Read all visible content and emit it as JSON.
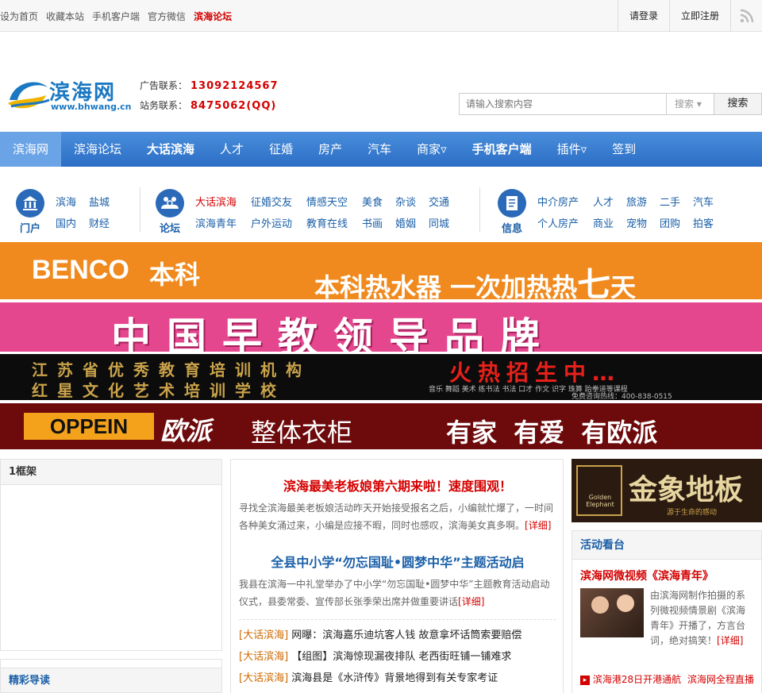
{
  "topbar": {
    "links": [
      "设为首页",
      "收藏本站",
      "手机客户端",
      "官方微信",
      "滨海论坛"
    ],
    "login": "请登录",
    "register": "立即注册"
  },
  "header": {
    "logo_text": "滨海网",
    "logo_url": "www.bhwang.cn",
    "ad_label": "广告联系：",
    "ad_value": "13092124567",
    "station_label": "站务联系：",
    "station_value": "8475062(QQ)",
    "search_placeholder": "请输入搜索内容",
    "search_select": "搜索",
    "search_button": "搜索"
  },
  "nav": [
    "滨海网",
    "滨海论坛",
    "大话滨海",
    "人才",
    "征婚",
    "房产",
    "汽车",
    "商家▿",
    "手机客户端",
    "插件▿",
    "签到"
  ],
  "quick": {
    "portal_label": "门户",
    "portal_links": [
      "滨海",
      "盐城",
      "国内",
      "财经"
    ],
    "forum_label": "论坛",
    "forum_row1": [
      "大话滨海",
      "征婚交友",
      "情感天空",
      "美食",
      "杂谈",
      "交通"
    ],
    "forum_row2": [
      "滨海青年",
      "户外运动",
      "教育在线",
      "书画",
      "婚姻",
      "同城"
    ],
    "info_label": "信息",
    "info_row1": [
      "中介房产",
      "人才",
      "旅游",
      "二手",
      "汽车"
    ],
    "info_row2": [
      "个人房产",
      "商业",
      "宠物",
      "团购",
      "拍客"
    ]
  },
  "banners": {
    "b1_brand": "BENCO",
    "b1_brand_cn": "本科",
    "b1_slogan": "本科热水器 一次加热热",
    "b1_big": "七",
    "b1_end": "天",
    "b2_text": "中国早教领导品牌",
    "b3_line1": "江苏省优秀教育培训机构",
    "b3_line2": "红星文化艺术培训学校",
    "b3_hot": "火热招生中…",
    "b3_small": "音乐 舞蹈 美术 练书法 书法 口才 作文 识字 珠算 跆拳道等课程",
    "b3_phone": "免费咨询热线：400-838-0515",
    "b4_brand": "OPPEIN",
    "b4_cn": "欧派",
    "b4_prod": "整体衣柜",
    "b4_slogan": "有家 有爱 有欧派"
  },
  "left": {
    "box1_title": "1框架",
    "box2_title": "精彩导读"
  },
  "center": {
    "title1": "滨海最美老板娘第六期来啦！速度围观！",
    "body1": "寻找全滨海最美老板娘活动昨天开始接受报名之后，小编就忙爆了，一时间各种美女涌过来，小编是应接不暇，同时也感叹，滨海美女真多啊。",
    "more1": "[详细]",
    "title2": "全县中小学“勿忘国耻•圆梦中华”主题活动启",
    "body2": "我县在滨海一中礼堂举办了中小学“勿忘国耻•圆梦中华”主题教育活动启动仪式，县委常委、宣传部长张季荣出席并做重要讲话",
    "more2": "[详细]",
    "list": [
      {
        "tag": "[大话滨海]",
        "text": "网曝：滨海嘉乐迪坑客人钱 故意拿坏话筒索要赔偿"
      },
      {
        "tag": "[大话滨海]",
        "text": "【组图】滨海惊现漏夜排队 老西街旺铺一铺难求"
      },
      {
        "tag": "[大话滨海]",
        "text": "滨海县是《水浒传》背景地得到有关专家考证"
      }
    ]
  },
  "right": {
    "ad_brand": "金象地板",
    "ad_en": "Golden Elephant",
    "ad_sub": "源于生命的感动",
    "box_title": "活动看台",
    "video_title": "滨海网微视频《滨海青年》",
    "video_desc": "由滨海网制作拍摄的系列微视频情景剧《滨海青年》开播了，方言台词，绝对搞笑！",
    "video_more": "[详细]",
    "bottom_a": "滨海港28日开港通航",
    "bottom_b": "滨海网全程直播"
  }
}
